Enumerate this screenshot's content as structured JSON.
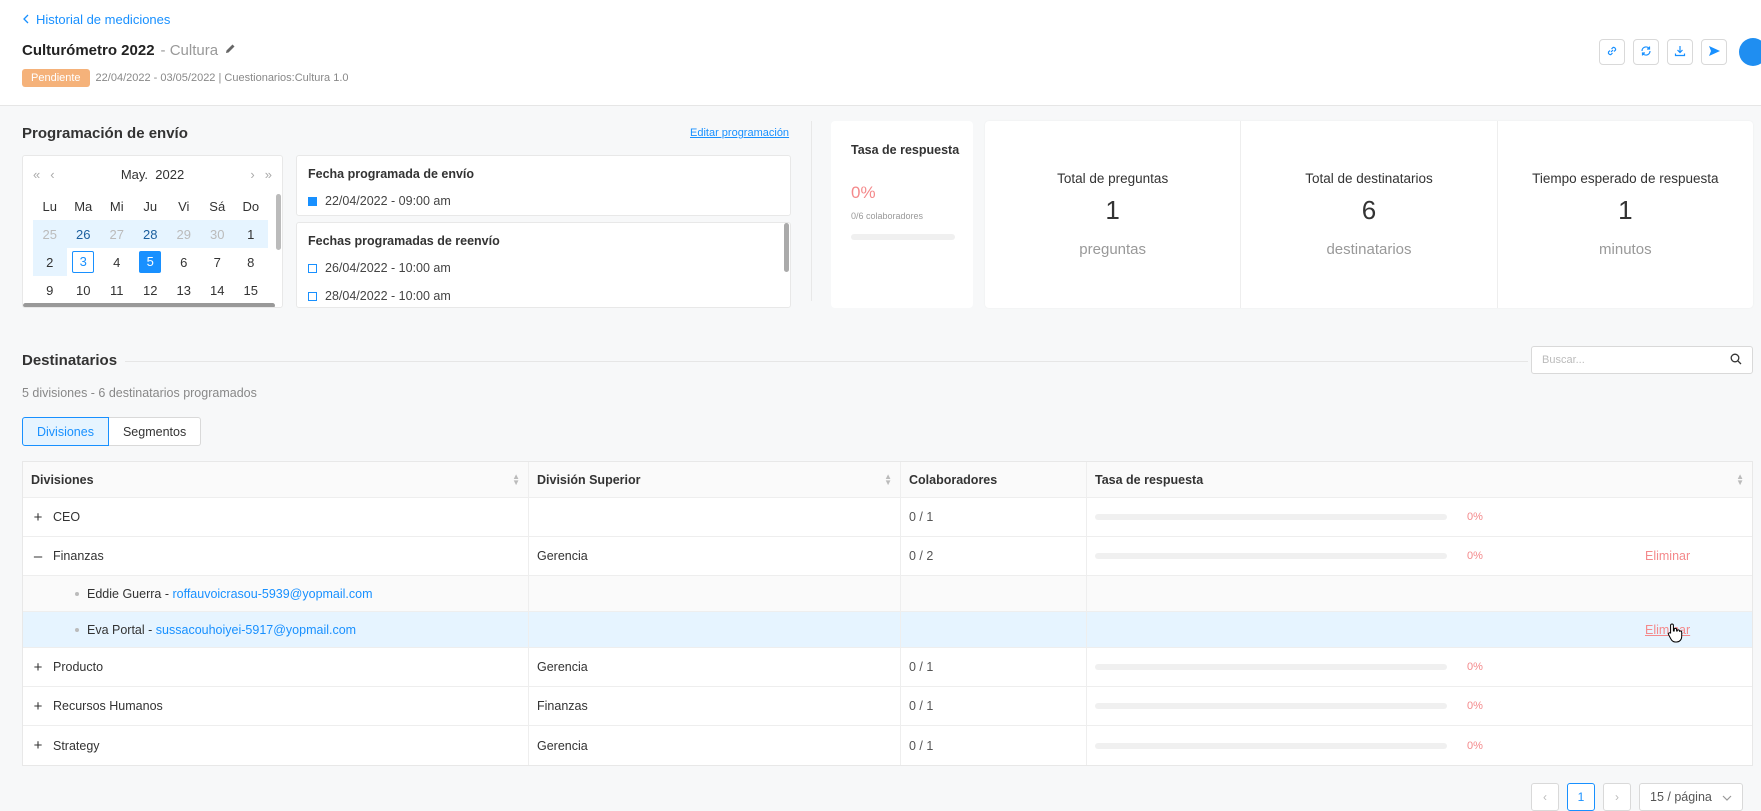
{
  "header": {
    "back_label": "Historial de mediciones",
    "title": "Culturómetro 2022",
    "title_sub": "- Cultura",
    "status": "Pendiente",
    "meta": "22/04/2022 - 03/05/2022 | Cuestionarios:Cultura 1.0",
    "toolbar_icons": [
      "link-icon",
      "refresh-icon",
      "download-icon",
      "send-icon"
    ]
  },
  "schedule": {
    "title": "Programación de envío",
    "edit_link": "Editar programación",
    "calendar": {
      "month": "May.",
      "year": "2022",
      "weekdays": [
        "Lu",
        "Ma",
        "Mi",
        "Ju",
        "Vi",
        "Sá",
        "Do"
      ],
      "week1": [
        "25",
        "26",
        "27",
        "28",
        "29",
        "30",
        "1"
      ],
      "week2": [
        "2",
        "3",
        "4",
        "5",
        "6",
        "7",
        "8"
      ],
      "week3": [
        "9",
        "10",
        "11",
        "12",
        "13",
        "14",
        "15"
      ]
    },
    "send": {
      "title": "Fecha programada de envío",
      "date": "22/04/2022 - 09:00 am"
    },
    "resend": {
      "title": "Fechas programadas de reenvío",
      "dates": [
        "26/04/2022 - 10:00 am",
        "28/04/2022 - 10:00 am"
      ]
    }
  },
  "rate": {
    "label": "Tasa de respuesta",
    "value": "0%",
    "sub": "0/6 colaboradores",
    "fraction": 0
  },
  "stats": [
    {
      "label": "Total de preguntas",
      "value": "1",
      "unit": "preguntas"
    },
    {
      "label": "Total de destinatarios",
      "value": "6",
      "unit": "destinatarios"
    },
    {
      "label": "Tiempo esperado de respuesta",
      "value": "1",
      "unit": "minutos"
    }
  ],
  "recipients": {
    "title": "Destinatarios",
    "search_placeholder": "Buscar...",
    "summary": "5 divisiones - 6 destinatarios programados",
    "tabs": [
      "Divisiones",
      "Segmentos"
    ],
    "columns": [
      "Divisiones",
      "División Superior",
      "Colaboradores",
      "Tasa de respuesta"
    ],
    "rows": {
      "r1": {
        "name": "CEO",
        "parent": "",
        "collab": "0 / 1",
        "rate": "0%",
        "expander": "+"
      },
      "r2": {
        "name": "Finanzas",
        "parent": "Gerencia",
        "collab": "0 / 2",
        "rate": "0%",
        "expander": "–",
        "action": "Eliminar"
      },
      "r2c1": {
        "name": "Eddie Guerra -",
        "email": "roffauvoicrasou-5939@yopmail.com"
      },
      "r2c2": {
        "name": "Eva Portal -",
        "email": "sussacouhoiyei-5917@yopmail.com",
        "action": "Eliminar"
      },
      "r3": {
        "name": "Producto",
        "parent": "Gerencia",
        "collab": "0 / 1",
        "rate": "0%",
        "expander": "+"
      },
      "r4": {
        "name": "Recursos Humanos",
        "parent": "Finanzas",
        "collab": "0 / 1",
        "rate": "0%",
        "expander": "+"
      },
      "r5": {
        "name": "Strategy",
        "parent": "Gerencia",
        "collab": "0 / 1",
        "rate": "0%",
        "expander": "+"
      }
    }
  },
  "pagination": {
    "current": "1",
    "page_size": "15 / página"
  },
  "colors": {
    "accent": "#1890ff",
    "status_pending": "#f5b27a",
    "danger": "#f4898b"
  }
}
